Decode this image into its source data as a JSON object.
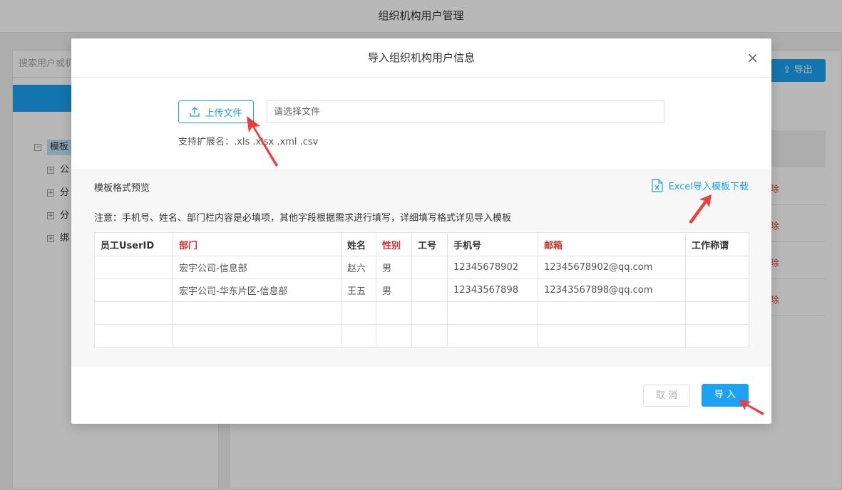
{
  "page": {
    "title": "组织机构用户管理",
    "search_placeholder": "搜索用户或机",
    "export_label": "导出",
    "tree_root": "模板",
    "tree_children": [
      "公",
      "分",
      "分",
      "绑"
    ],
    "delete_fragment": "除"
  },
  "modal": {
    "title": "导入组织机构用户信息",
    "close_symbol": "×",
    "upload_label": "上传文件",
    "file_placeholder": "请选择文件",
    "ext_hint": "支持扩展名：.xls .xlsx .xml .csv",
    "preview_title": "模板格式预览",
    "excel_link": "Excel导入模板下载",
    "notice": "注意：手机号、姓名、部门栏内容是必填项，其他字段根据需求进行填写，详细填写格式详见导入模板",
    "table": {
      "headers": [
        "员工UserID",
        "部门",
        "姓名",
        "性别",
        "工号",
        "手机号",
        "邮箱",
        "工作称谓"
      ],
      "rows": [
        [
          "",
          "宏宇公司-信息部",
          "赵六",
          "男",
          "",
          "12345678902",
          "12345678902@qq.com",
          ""
        ],
        [
          "",
          "宏宇公司-华东片区-信息部",
          "王五",
          "男",
          "",
          "12343567898",
          "12343567898@qq.com",
          ""
        ],
        [
          "",
          "",
          "",
          "",
          "",
          "",
          "",
          ""
        ],
        [
          "",
          "",
          "",
          "",
          "",
          "",
          "",
          ""
        ]
      ]
    },
    "cancel_label": "取 消",
    "import_label": "导 入"
  },
  "colors": {
    "accent": "#1da1f2",
    "required": "#d32f2f",
    "annotation_arrow": "#f23d3d"
  },
  "icons": [
    "upload-icon",
    "excel-file-icon",
    "close-icon",
    "tree-expand-icon",
    "annotation-arrow"
  ]
}
